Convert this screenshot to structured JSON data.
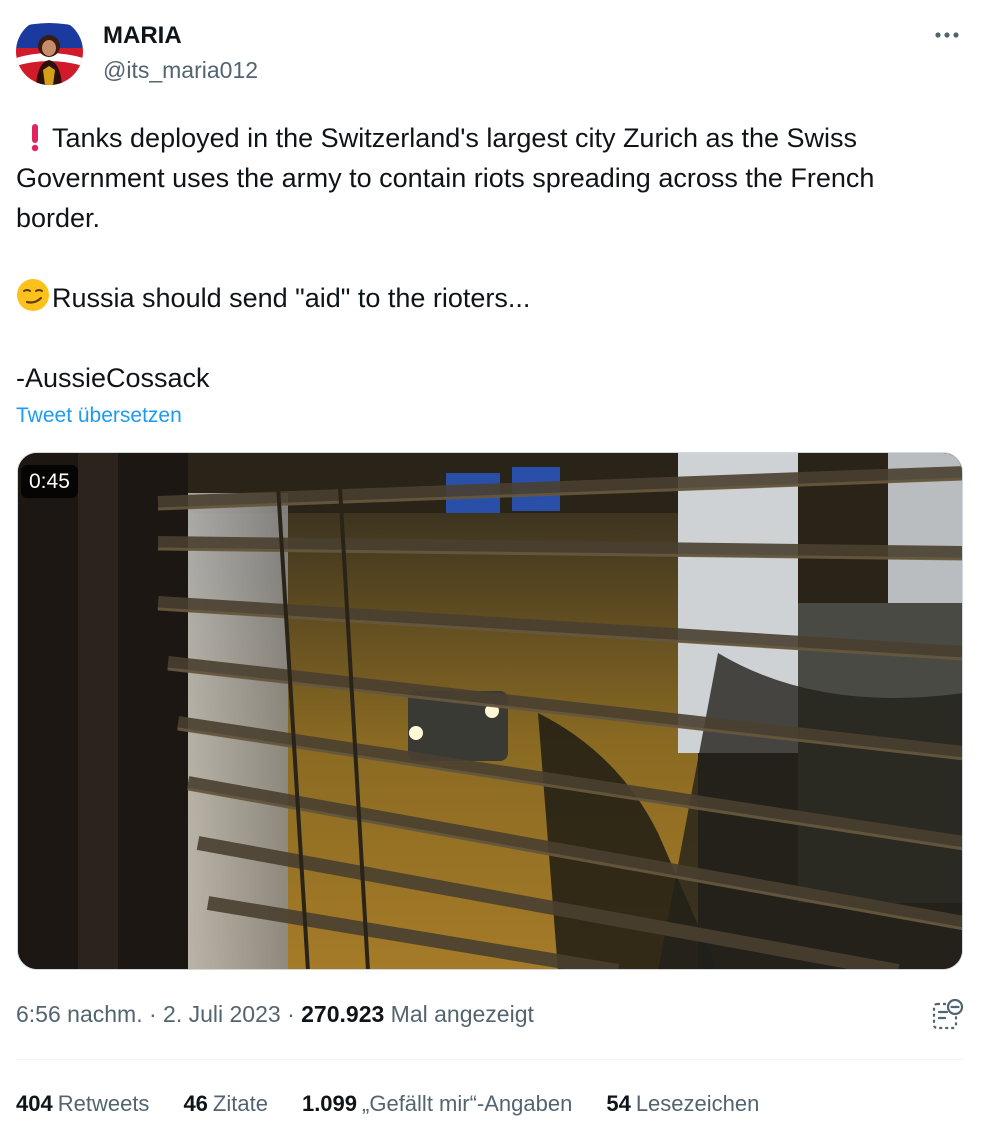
{
  "author": {
    "display_name": "MARIA",
    "handle": "@its_maria012",
    "avatar_icon": "avatar"
  },
  "more_icon": "more-icon",
  "tweet": {
    "lines": [
      "Tanks deployed in the Switzerland's largest city Zurich as  the Swiss",
      "Government uses the army to contain riots spreading across the French",
      "border."
    ],
    "line2": "Russia should send \"aid\" to the rioters...",
    "signature": "-AussieCossack",
    "icons": [
      "exclamation-icon",
      "smirk-emoji-icon"
    ]
  },
  "translate_link": "Tweet übersetzen",
  "video": {
    "duration": "0:45"
  },
  "meta": {
    "time": "6:56 nachm.",
    "sep1": " · ",
    "date": "2. Juli 2023",
    "sep2": " · ",
    "views": "270.923",
    "views_label": " Mal angezeigt"
  },
  "stats": [
    {
      "num": "404",
      "label": "Retweets"
    },
    {
      "num": "46",
      "label": "Zitate"
    },
    {
      "num": "1.099",
      "label": "„Gefällt mir“-Angaben"
    },
    {
      "num": "54",
      "label": "Lesezeichen"
    }
  ],
  "colors": {
    "link": "#1d9bf0",
    "secondary_text": "#536471",
    "primary_text": "#0f1419",
    "exclamation": "#e0245e"
  }
}
